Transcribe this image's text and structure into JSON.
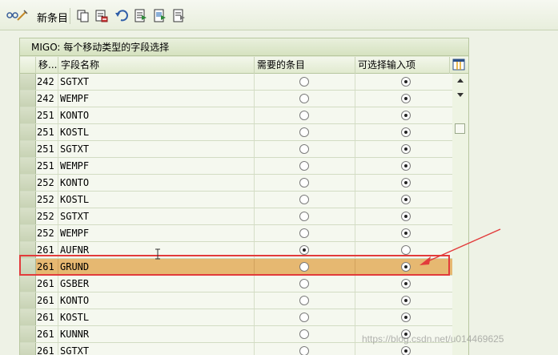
{
  "toolbar": {
    "new_entries_label": "新条目"
  },
  "panel": {
    "title": "MIGO: 每个移动类型的字段选择"
  },
  "table": {
    "columns": [
      "移...",
      "字段名称",
      "需要的条目",
      "可选择输入项"
    ],
    "rows": [
      {
        "mvt": "242",
        "field": "SGTXT",
        "required": false,
        "optional": true
      },
      {
        "mvt": "242",
        "field": "WEMPF",
        "required": false,
        "optional": true
      },
      {
        "mvt": "251",
        "field": "KONTO",
        "required": false,
        "optional": true
      },
      {
        "mvt": "251",
        "field": "KOSTL",
        "required": false,
        "optional": true
      },
      {
        "mvt": "251",
        "field": "SGTXT",
        "required": false,
        "optional": true
      },
      {
        "mvt": "251",
        "field": "WEMPF",
        "required": false,
        "optional": true
      },
      {
        "mvt": "252",
        "field": "KONTO",
        "required": false,
        "optional": true
      },
      {
        "mvt": "252",
        "field": "KOSTL",
        "required": false,
        "optional": true
      },
      {
        "mvt": "252",
        "field": "SGTXT",
        "required": false,
        "optional": true
      },
      {
        "mvt": "252",
        "field": "WEMPF",
        "required": false,
        "optional": true
      },
      {
        "mvt": "261",
        "field": "AUFNR",
        "required": true,
        "optional": false
      },
      {
        "mvt": "261",
        "field": "GRUND",
        "required": false,
        "optional": true,
        "highlighted": true
      },
      {
        "mvt": "261",
        "field": "GSBER",
        "required": false,
        "optional": true
      },
      {
        "mvt": "261",
        "field": "KONTO",
        "required": false,
        "optional": true
      },
      {
        "mvt": "261",
        "field": "KOSTL",
        "required": false,
        "optional": true
      },
      {
        "mvt": "261",
        "field": "KUNNR",
        "required": false,
        "optional": true
      },
      {
        "mvt": "261",
        "field": "SGTXT",
        "required": false,
        "optional": true
      }
    ]
  },
  "watermark": "https://blog.csdn.net/u014469625",
  "colors": {
    "highlight_row": "#e6b871",
    "annotation": "#e23b3b"
  }
}
